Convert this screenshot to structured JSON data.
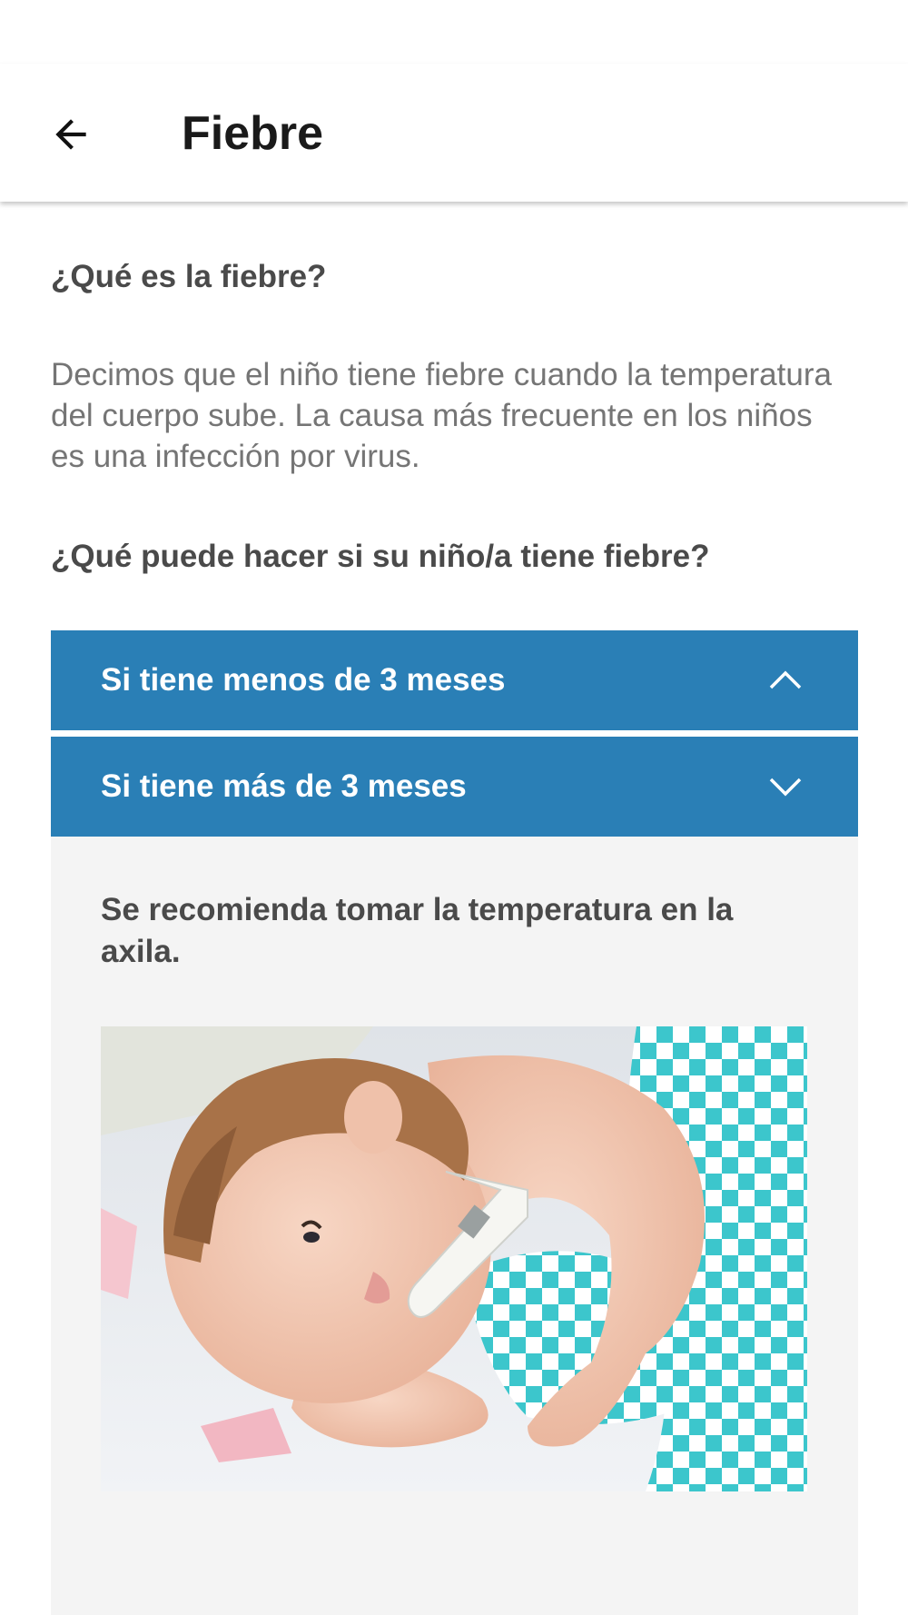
{
  "toolbar": {
    "back_icon": "arrow-left-icon",
    "title": "Fiebre"
  },
  "content": {
    "heading_1": "¿Qué es la fiebre?",
    "paragraph_1": "Decimos que el niño tiene fiebre cuando la temperatura del cuerpo sube. La causa más frecuente en los niños es una infección por virus.",
    "heading_2": "¿Qué puede hacer si su niño/a tiene fiebre?",
    "accordion": [
      {
        "label": "Si tiene menos de 3 meses",
        "icon": "chevron-up-icon"
      },
      {
        "label": "Si tiene más de 3 meses",
        "icon": "chevron-down-icon"
      }
    ],
    "panel_text": "Se recomienda tomar la temperatura en la axila."
  },
  "colors": {
    "accent": "#2a7fb6",
    "panel_bg": "#f4f4f4",
    "heading_text": "#4a4a4a",
    "body_text": "#757575"
  }
}
